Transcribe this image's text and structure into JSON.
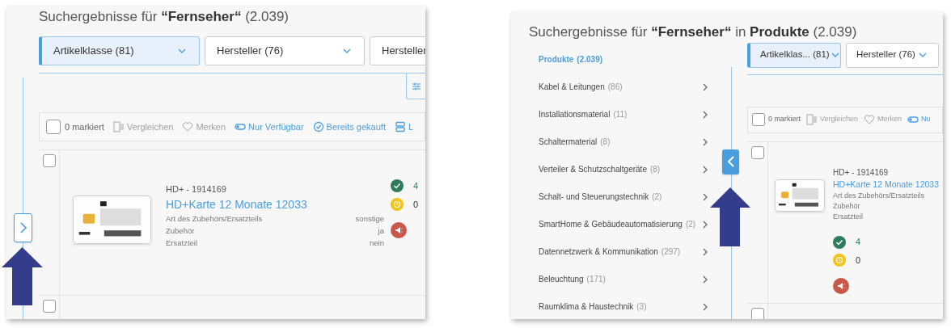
{
  "views": [
    {
      "heading": "Suchergebnisse für **“Fernseher“** (2.039)",
      "sidebar_toggle": {
        "expanded": false
      },
      "filters": [
        {
          "label": "Artikelklasse (81)",
          "selected": true
        },
        {
          "label": "Hersteller (76)",
          "selected": false
        },
        {
          "label": "Hersteller",
          "selected": false
        }
      ],
      "settings_tab": true,
      "toolbar": [
        {
          "kind": "select",
          "label": "0 markiert",
          "checked": false
        },
        {
          "kind": "compare",
          "label": "Vergleichen",
          "disabled": true
        },
        {
          "kind": "bookmark",
          "label": "Merken",
          "disabled": true
        },
        {
          "kind": "availability",
          "label": "Nur Verfügbar",
          "disabled": false
        },
        {
          "kind": "purchased",
          "label": "Bereits gekauft",
          "disabled": false
        },
        {
          "kind": "view",
          "label": "L"
        }
      ],
      "next_row": {
        "selected": false
      },
      "product": {
        "brand": "HD+ - 1914169",
        "name": "HD+Karte 12 Monate 12033",
        "attributes": [
          {
            "name": "Art des Zubehörs/Ersatzteils",
            "value": "sonstige"
          },
          {
            "name": "Zubehör",
            "value": "ja"
          },
          {
            "name": "Ersatzteil",
            "value": "nein"
          }
        ],
        "stock": [
          {
            "kind": "available",
            "count": "4"
          },
          {
            "kind": "pending",
            "count": "0"
          }
        ],
        "selected": false
      }
    },
    {
      "heading": "Suchergebnisse für **“Fernseher“** in **Produkte** (2.039)",
      "sidebar_toggle": {
        "expanded": true
      },
      "categories": [
        {
          "label": "Produkte",
          "count": "(2.039)",
          "selected": true
        },
        {
          "label": "Kabel & Leitungen",
          "count": "(86)",
          "selected": false
        },
        {
          "label": "Installationsmaterial",
          "count": "(11)",
          "selected": false
        },
        {
          "label": "Schaltermaterial",
          "count": "(8)",
          "selected": false
        },
        {
          "label": "Verteiler & Schutzschaltgeräte",
          "count": "(8)",
          "selected": false
        },
        {
          "label": "Schalt- und Steuerungstechnik",
          "count": "(2)",
          "selected": false
        },
        {
          "label": "SmartHome & Gebäudeautomatisierung",
          "count": "(2)",
          "selected": false
        },
        {
          "label": "Datennetzwerk & Kommunikation",
          "count": "(297)",
          "selected": false
        },
        {
          "label": "Beleuchtung",
          "count": "(171)",
          "selected": false
        },
        {
          "label": "Raumklima & Haustechnik",
          "count": "(3)",
          "selected": false
        }
      ],
      "filters": [
        {
          "label": "Artikelklas... (81)",
          "selected": true
        },
        {
          "label": "Hersteller (76)",
          "selected": false
        }
      ],
      "settings_tab": false,
      "toolbar": [
        {
          "kind": "select",
          "label": "0 markiert",
          "checked": false
        },
        {
          "kind": "compare",
          "label": "Vergleichen",
          "disabled": true
        },
        {
          "kind": "bookmark",
          "label": "Merken",
          "disabled": true
        },
        {
          "kind": "availability",
          "label": "Nu",
          "disabled": false
        }
      ],
      "next_row": {
        "selected": false
      },
      "product": {
        "brand": "HD+ - 1914169",
        "name": "HD+Karte 12 Monate 12033",
        "attributes": [
          {
            "name": "Art des Zubehörs/Ersatzteils"
          },
          {
            "name": "Zubehör"
          },
          {
            "name": "Ersatzteil"
          }
        ],
        "stock": [
          {
            "kind": "available",
            "count": "4"
          },
          {
            "kind": "pending",
            "count": "0"
          }
        ],
        "selected": false
      }
    }
  ]
}
